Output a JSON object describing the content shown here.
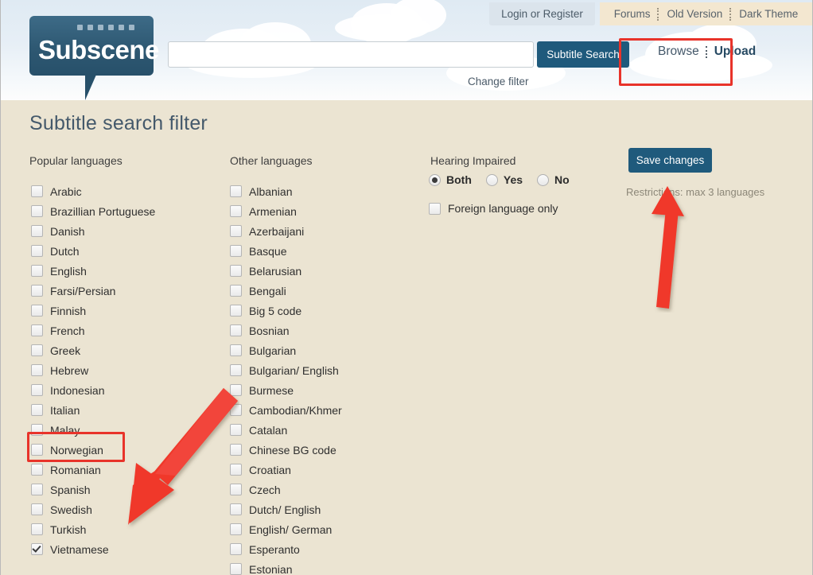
{
  "header": {
    "login_label": "Login or Register",
    "util_links": [
      "Forums",
      "Old Version",
      "Dark Theme"
    ],
    "logo_text": "Subscene",
    "search_value": "",
    "search_placeholder": "",
    "search_button": "Subtitle Search",
    "nav_browse": "Browse",
    "nav_upload": "Upload",
    "change_filter": "Change filter"
  },
  "page": {
    "title": "Subtitle search filter"
  },
  "popular": {
    "heading": "Popular languages",
    "items": [
      {
        "label": "Arabic",
        "checked": false
      },
      {
        "label": "Brazillian Portuguese",
        "checked": false
      },
      {
        "label": "Danish",
        "checked": false
      },
      {
        "label": "Dutch",
        "checked": false
      },
      {
        "label": "English",
        "checked": false
      },
      {
        "label": "Farsi/Persian",
        "checked": false
      },
      {
        "label": "Finnish",
        "checked": false
      },
      {
        "label": "French",
        "checked": false
      },
      {
        "label": "Greek",
        "checked": false
      },
      {
        "label": "Hebrew",
        "checked": false
      },
      {
        "label": "Indonesian",
        "checked": false
      },
      {
        "label": "Italian",
        "checked": false
      },
      {
        "label": "Malay",
        "checked": false
      },
      {
        "label": "Norwegian",
        "checked": false
      },
      {
        "label": "Romanian",
        "checked": false
      },
      {
        "label": "Spanish",
        "checked": false
      },
      {
        "label": "Swedish",
        "checked": false
      },
      {
        "label": "Turkish",
        "checked": false
      },
      {
        "label": "Vietnamese",
        "checked": true
      }
    ]
  },
  "other": {
    "heading": "Other languages",
    "items": [
      {
        "label": "Albanian",
        "checked": false
      },
      {
        "label": "Armenian",
        "checked": false
      },
      {
        "label": "Azerbaijani",
        "checked": false
      },
      {
        "label": "Basque",
        "checked": false
      },
      {
        "label": "Belarusian",
        "checked": false
      },
      {
        "label": "Bengali",
        "checked": false
      },
      {
        "label": "Big 5 code",
        "checked": false
      },
      {
        "label": "Bosnian",
        "checked": false
      },
      {
        "label": "Bulgarian",
        "checked": false
      },
      {
        "label": "Bulgarian/ English",
        "checked": false
      },
      {
        "label": "Burmese",
        "checked": false
      },
      {
        "label": "Cambodian/Khmer",
        "checked": false
      },
      {
        "label": "Catalan",
        "checked": false
      },
      {
        "label": "Chinese BG code",
        "checked": false
      },
      {
        "label": "Croatian",
        "checked": false
      },
      {
        "label": "Czech",
        "checked": false
      },
      {
        "label": "Dutch/ English",
        "checked": false
      },
      {
        "label": "English/ German",
        "checked": false
      },
      {
        "label": "Esperanto",
        "checked": false
      },
      {
        "label": "Estonian",
        "checked": false
      }
    ]
  },
  "hearing_impaired": {
    "heading": "Hearing Impaired",
    "options": [
      {
        "label": "Both",
        "selected": true
      },
      {
        "label": "Yes",
        "selected": false
      },
      {
        "label": "No",
        "selected": false
      }
    ],
    "foreign_only": {
      "label": "Foreign language only",
      "checked": false
    }
  },
  "actions": {
    "save_label": "Save changes",
    "restrictions": "Restrictions: max 3 languages"
  },
  "annotations": {
    "accent_color": "#e8332a",
    "arrow_to_vietnamese": "red-arrow-down-left",
    "arrow_to_restrictions": "red-arrow-up"
  },
  "colors": {
    "brand_blue": "#1f5a7c",
    "page_background": "#ebe4d2",
    "header_background": "#e3ecf4",
    "annotation_red": "#e8332a"
  }
}
